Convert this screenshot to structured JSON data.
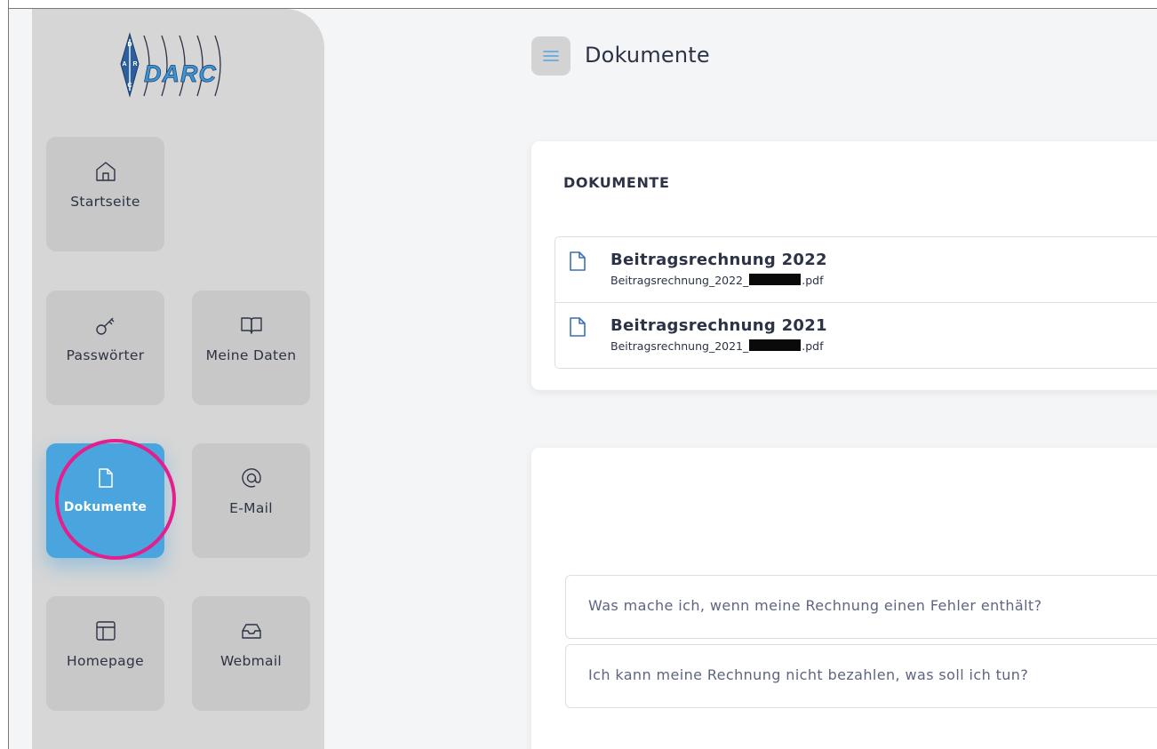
{
  "brand": {
    "logo_text": "DARC",
    "emblem_letters": "DARC"
  },
  "sidebar": {
    "items": [
      {
        "label": "Startseite",
        "icon": "home-icon"
      },
      {
        "label": "Passwörter",
        "icon": "key-icon"
      },
      {
        "label": "Meine Daten",
        "icon": "book-icon"
      },
      {
        "label": "Dokumente",
        "icon": "document-icon",
        "active": true
      },
      {
        "label": "E-Mail",
        "icon": "at-sign-icon"
      },
      {
        "label": "Homepage",
        "icon": "layout-icon"
      },
      {
        "label": "Webmail",
        "icon": "inbox-icon"
      }
    ]
  },
  "header": {
    "menu_icon": "hamburger-menu-icon",
    "title": "Dokumente"
  },
  "documents": {
    "heading": "DOKUMENTE",
    "items": [
      {
        "title": "Beitragsrechnung 2022",
        "file_prefix": "Beitragsrechnung_2022_",
        "file_suffix": "pdf"
      },
      {
        "title": "Beitragsrechnung 2021",
        "file_prefix": "Beitragsrechnung_2021_",
        "file_suffix": "pdf"
      }
    ]
  },
  "faq": {
    "items": [
      {
        "question": "Was mache ich, wenn meine Rechnung einen Fehler enthält?"
      },
      {
        "question": "Ich kann meine Rechnung nicht bezahlen, was soll ich tun?"
      }
    ]
  },
  "colors": {
    "accent": "#4aa5de",
    "highlight": "#e41e8c",
    "sidebar_bg": "#d6d6d6",
    "tile_bg": "#c8c8c8",
    "page_bg": "#f4f5f7"
  }
}
